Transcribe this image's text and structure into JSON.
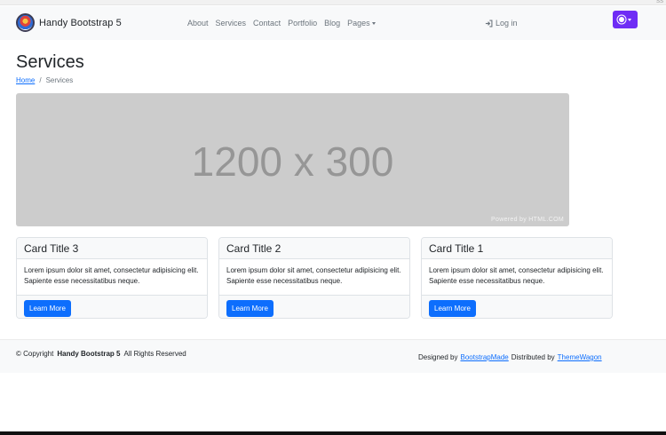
{
  "corner_mark": "SS",
  "navbar": {
    "brand": "Handy Bootstrap 5",
    "links": [
      "About",
      "Services",
      "Contact",
      "Portfolio",
      "Blog"
    ],
    "dropdown_label": "Pages",
    "login_label": "Log in",
    "theme_button_icon": "sun-icon",
    "theme_button_color": "#6f2cf5"
  },
  "page": {
    "title": "Services",
    "breadcrumb": {
      "home": "Home",
      "separator": "/",
      "current": "Services"
    }
  },
  "hero": {
    "text": "1200 x 300",
    "credit": "Powered by HTML.COM"
  },
  "cards": [
    {
      "title": "Card Title 3",
      "body": "Lorem ipsum dolor sit amet, consectetur adipisicing elit. Sapiente esse necessitatibus neque.",
      "button": "Learn More"
    },
    {
      "title": "Card Title 2",
      "body": "Lorem ipsum dolor sit amet, consectetur adipisicing elit. Sapiente esse necessitatibus neque.",
      "button": "Learn More"
    },
    {
      "title": "Card Title 1",
      "body": "Lorem ipsum dolor sit amet, consectetur adipisicing elit. Sapiente esse necessitatibus neque.",
      "button": "Learn More"
    }
  ],
  "footer": {
    "copyright_prefix": "© Copyright",
    "copyright_brand": "Handy Bootstrap 5",
    "copyright_suffix": "All Rights Reserved",
    "designed_by_label": "Designed by",
    "designed_by_link": "BootstrapMade",
    "distributed_by_label": "Distributed by",
    "distributed_by_link": "ThemeWagon"
  },
  "colors": {
    "primary": "#0d6efd",
    "navbar_bg": "#f8f9fa",
    "hero_bg": "#cccccc"
  }
}
